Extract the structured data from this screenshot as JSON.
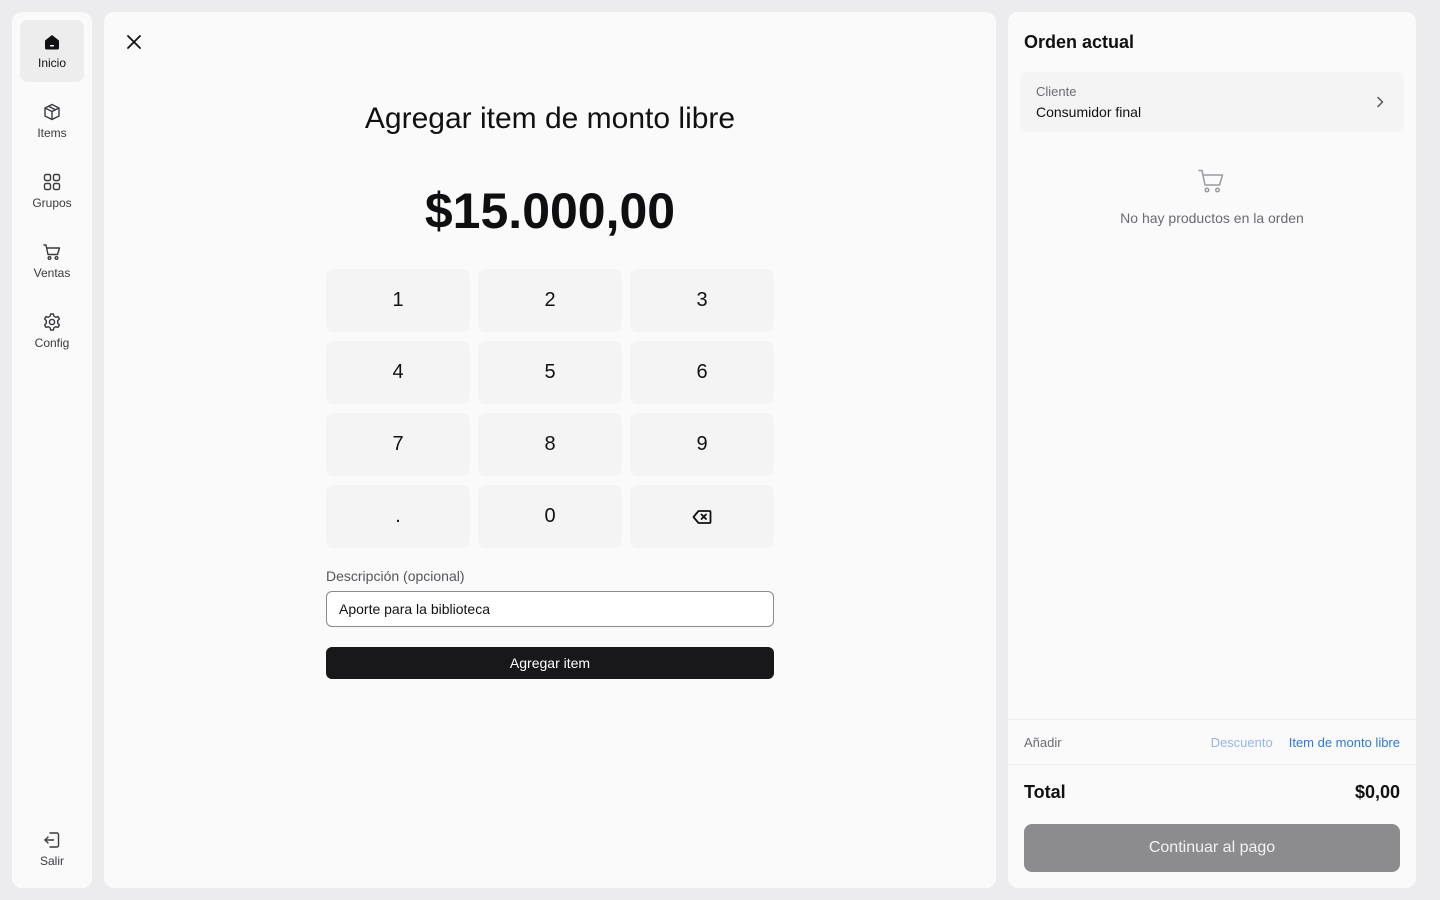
{
  "sidebar": {
    "items": [
      {
        "label": "Inicio",
        "icon": "home-icon",
        "active": true
      },
      {
        "label": "Items",
        "icon": "box-icon"
      },
      {
        "label": "Grupos",
        "icon": "grid-icon"
      },
      {
        "label": "Ventas",
        "icon": "cart-icon"
      },
      {
        "label": "Config",
        "icon": "gear-icon"
      }
    ],
    "exit": {
      "label": "Salir",
      "icon": "logout-icon"
    }
  },
  "main": {
    "close_icon": "close-icon",
    "title": "Agregar item de monto libre",
    "amount": "$15.000,00",
    "keypad": [
      "1",
      "2",
      "3",
      "4",
      "5",
      "6",
      "7",
      "8",
      "9",
      ".",
      "0",
      "backspace-icon"
    ],
    "description": {
      "label": "Descripción (opcional)",
      "value": "Aporte para la biblioteca"
    },
    "add_button": "Agregar item"
  },
  "order": {
    "title": "Orden actual",
    "customer": {
      "label": "Cliente",
      "value": "Consumidor final"
    },
    "empty_icon": "cart-icon",
    "empty_text": "No hay productos en la orden",
    "add_label": "Añadir",
    "add_links": {
      "discount": "Descuento",
      "free_item": "Item de monto libre"
    },
    "total_label": "Total",
    "total_value": "$0,00",
    "pay_button": "Continuar al pago"
  },
  "colors": {
    "primary_button": "#18181b",
    "link": "#2f7ad6",
    "link_muted": "#93b6e9",
    "disabled_button": "#8c8c8e"
  }
}
